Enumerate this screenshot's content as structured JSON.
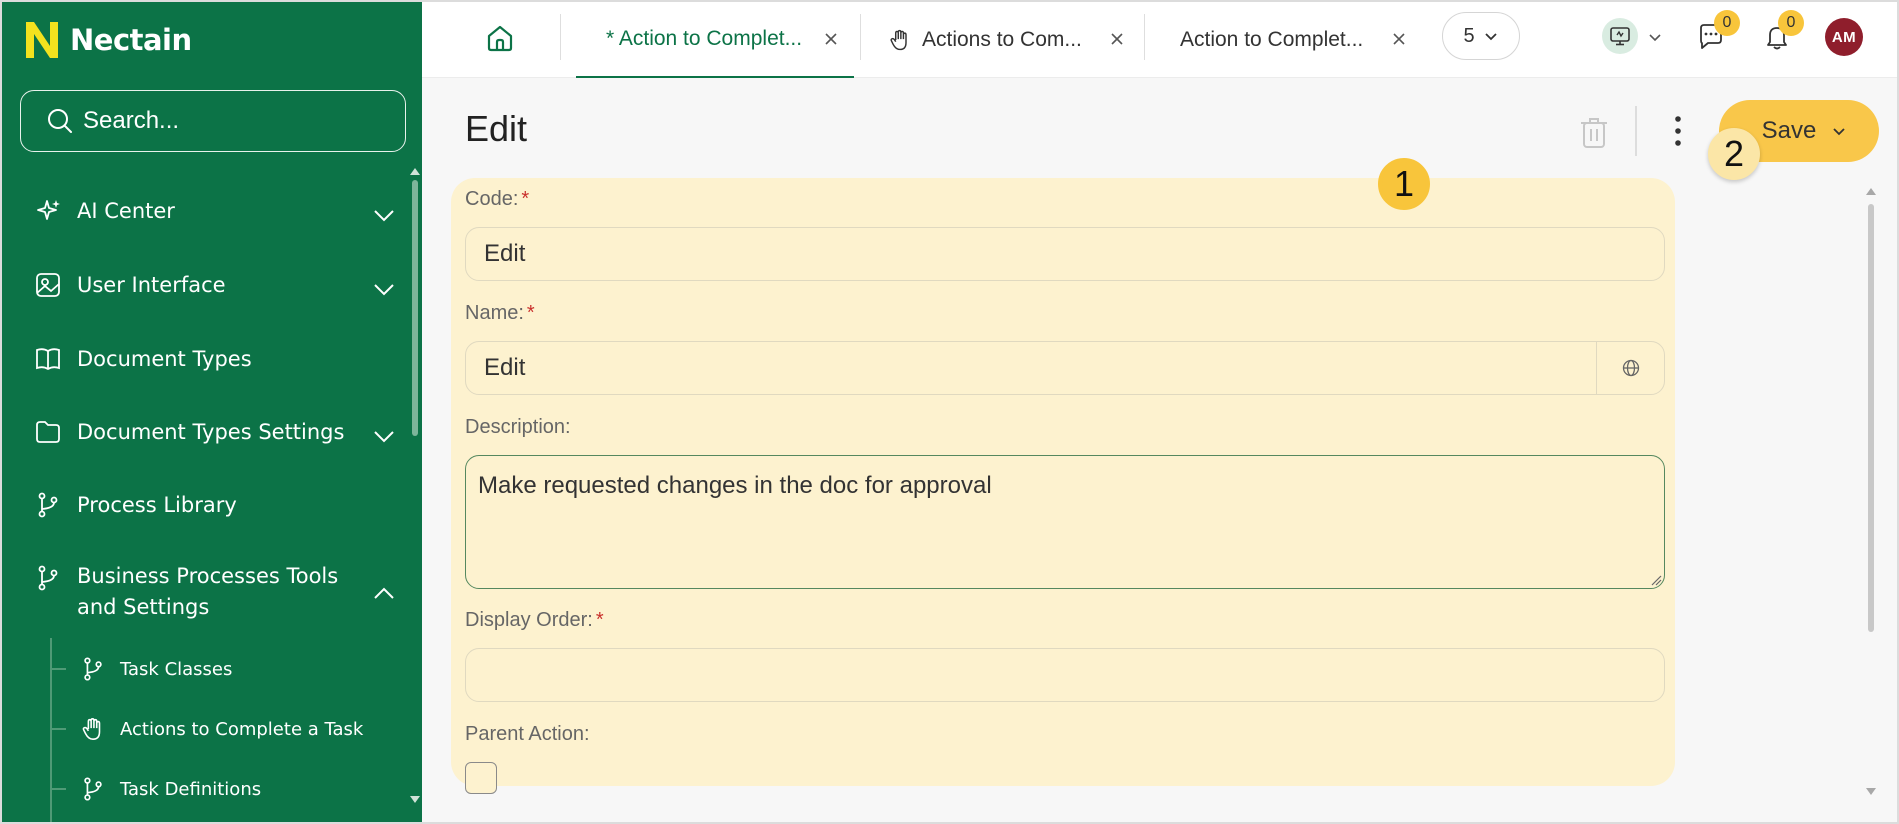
{
  "app": {
    "name": "Nectain"
  },
  "sidebar": {
    "search_placeholder": "Search...",
    "items": [
      {
        "label": "AI Center"
      },
      {
        "label": "User Interface"
      },
      {
        "label": "Document Types"
      },
      {
        "label": "Document Types Settings"
      },
      {
        "label": "Process Library"
      },
      {
        "label_line1": "Business Processes Tools",
        "label_line2": "and Settings"
      }
    ],
    "sub_items": [
      {
        "label": "Task Classes"
      },
      {
        "label": "Actions to Complete a Task"
      },
      {
        "label": "Task Definitions"
      }
    ]
  },
  "topbar": {
    "tabs": [
      {
        "label": "* Action to Complet..."
      },
      {
        "label": "Actions to Com..."
      },
      {
        "label": "Action to Complet..."
      }
    ],
    "tab_count": "5",
    "chat_badge": "0",
    "notification_badge": "0",
    "avatar_initials": "AM"
  },
  "page": {
    "title": "Edit",
    "save_label": "Save",
    "step_1": "1",
    "step_2": "2"
  },
  "form": {
    "code_label": "Code:",
    "code_value": "Edit",
    "name_label": "Name:",
    "name_value": "Edit",
    "description_label": "Description:",
    "description_value": "Make requested changes in the doc for approval",
    "display_order_label": "Display Order:",
    "display_order_value": "",
    "parent_action_label": "Parent Action:",
    "required_mark": "*"
  },
  "colors": {
    "sidebar_bg": "#0c7347",
    "accent": "#f9c74a",
    "form_bg": "#fdf2cf",
    "avatar_bg": "#8f1e2c"
  }
}
